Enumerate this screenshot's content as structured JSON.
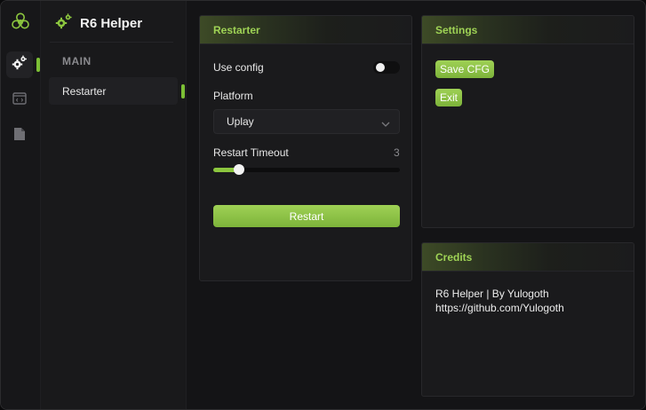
{
  "app": {
    "title": "R6 Helper"
  },
  "nav": {
    "section_label": "MAIN",
    "items": [
      {
        "label": "Restarter",
        "active": true
      }
    ]
  },
  "rail": {
    "icons": [
      "biohazard-logo",
      "gears-icon",
      "code-window-icon",
      "document-icon"
    ],
    "active_index": 0
  },
  "restarter": {
    "header": "Restarter",
    "use_config_label": "Use config",
    "use_config_on": false,
    "platform_label": "Platform",
    "platform_value": "Uplay",
    "timeout_label": "Restart Timeout",
    "timeout_value": "3",
    "timeout_fraction": 0.14,
    "restart_button": "Restart"
  },
  "settings": {
    "header": "Settings",
    "save_button": "Save CFG",
    "exit_button": "Exit"
  },
  "credits": {
    "header": "Credits",
    "line1": "R6 Helper | By Yulogoth",
    "line2": "https://github.com/Yulogoth"
  },
  "colors": {
    "accent": "#8cc63f",
    "accent_text": "#9fd355",
    "background": "#141416"
  }
}
